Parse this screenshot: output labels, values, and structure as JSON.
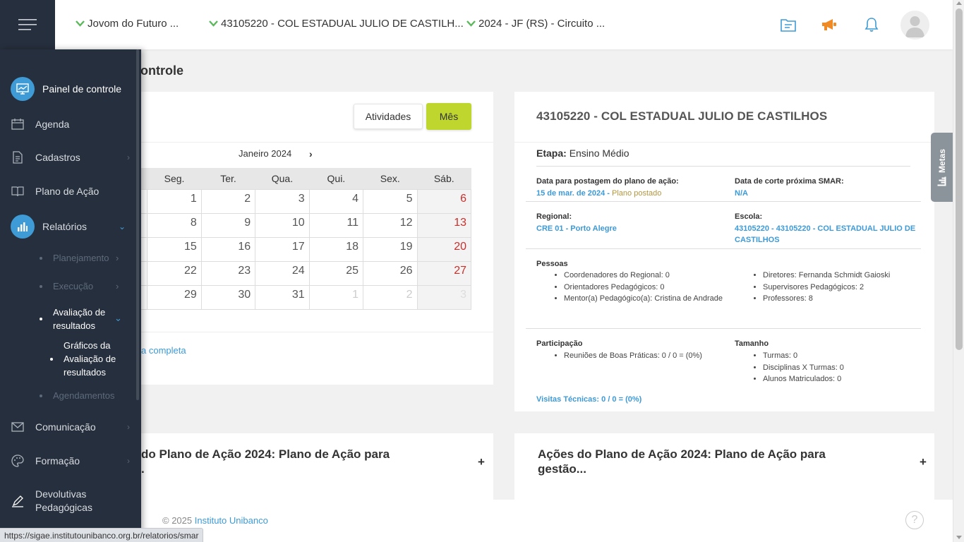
{
  "topbar": {
    "selector_program": "Jovom do Futuro ...",
    "selector_school": "43105220 - COL ESTADUAL JULIO DE CASTILH...",
    "selector_cycle": "2024 - JF (RS) - Circuito ..."
  },
  "page": {
    "title": "l de Controle"
  },
  "calendar": {
    "btn_atividades": "Atividades",
    "btn_mes": "Mês",
    "month_label": "Janeiro 2024",
    "next_label": "›",
    "weekdays": [
      "",
      "Seg.",
      "Ter.",
      "Qua.",
      "Qui.",
      "Sex.",
      "Sáb."
    ],
    "weeks": [
      [
        "",
        "1",
        "2",
        "3",
        "4",
        "5",
        "6"
      ],
      [
        "",
        "8",
        "9",
        "10",
        "11",
        "12",
        "13"
      ],
      [
        "",
        "15",
        "16",
        "17",
        "18",
        "19",
        "20"
      ],
      [
        "",
        "22",
        "23",
        "24",
        "25",
        "26",
        "27"
      ],
      [
        "",
        "29",
        "30",
        "31",
        "1",
        "2",
        "3"
      ]
    ],
    "link_text": "a completa"
  },
  "info": {
    "title": "43105220 - COL ESTADUAL JULIO DE CASTILHOS",
    "etapa_label": "Etapa:",
    "etapa_value": "Ensino Médio",
    "data_postagem_label": "Data para postagem do plano de ação:",
    "data_postagem_value": "15 de mar. de 2024 -",
    "data_postagem_status": "Plano postado",
    "data_corte_label": "Data de corte próxima SMAR:",
    "data_corte_value": "N/A",
    "regional_label": "Regional:",
    "regional_value": "CRE 01 - Porto Alegre",
    "escola_label": "Escola:",
    "escola_value": "43105220 - 43105220 - COL ESTADUAL JULIO DE CASTILHOS",
    "pessoas_label": "Pessoas",
    "pessoas_left": [
      "Coordenadores do Regional: 0",
      "Orientadores Pedagógicos: 0",
      "Mentor(a) Pedagógico(a): Cristina de Andrade"
    ],
    "pessoas_right": [
      "Diretores: Fernanda Schmidt Gaioski",
      "Supervisores Pedagógicos: 2",
      "Professores: 8"
    ],
    "participacao_label": "Participação",
    "participacao_items": [
      "Reuniões de Boas Práticas: 0 / 0 = (0%)"
    ],
    "tamanho_label": "Tamanho",
    "tamanho_items": [
      "Turmas: 0",
      "Disciplinas X Turmas: 0",
      "Alunos Matriculados: 0"
    ],
    "visitas_label": "Visitas Técnicas:",
    "visitas_value": "0 / 0 = (0%)"
  },
  "metas_tab": {
    "label": "Metas"
  },
  "bottom_cards": {
    "left_title_line1": "do Plano de Ação 2024: Plano de Ação para",
    "left_title_line2": ".",
    "right_title_line1": "Ações do Plano de Ação 2024: Plano de Ação para",
    "right_title_line2": "gestão...",
    "expand_label": "+"
  },
  "footer": {
    "copyright": "© 2025",
    "brand": "Instituto Unibanco",
    "help": "?"
  },
  "sidebar": {
    "painel": "Painel de controle",
    "agenda": "Agenda",
    "cadastros": "Cadastros",
    "plano": "Plano de Ação",
    "relatorios": "Relatórios",
    "planejamento": "Planejamento",
    "execucao": "Execução",
    "avaliacao_line1": "Avaliação de",
    "avaliacao_line2": "resultados",
    "graficos_line1": "Gráficos da",
    "graficos_line2": "Avaliação de",
    "graficos_line3": "resultados",
    "agendamentos": "Agendamentos",
    "comunicacao": "Comunicação",
    "formacao": "Formação",
    "devolutivas_line1": "Devolutivas",
    "devolutivas_line2": "Pedagógicas"
  },
  "status_bar": {
    "url": "https://sigae.institutounibanco.org.br/relatorios/smar"
  },
  "colors": {
    "sidebar_bg": "#262f3d",
    "accent_blue": "#3f9bd6",
    "accent_green": "#bfd62f",
    "link_blue": "#3b9ad9",
    "weekend_red": "#c9302c"
  }
}
